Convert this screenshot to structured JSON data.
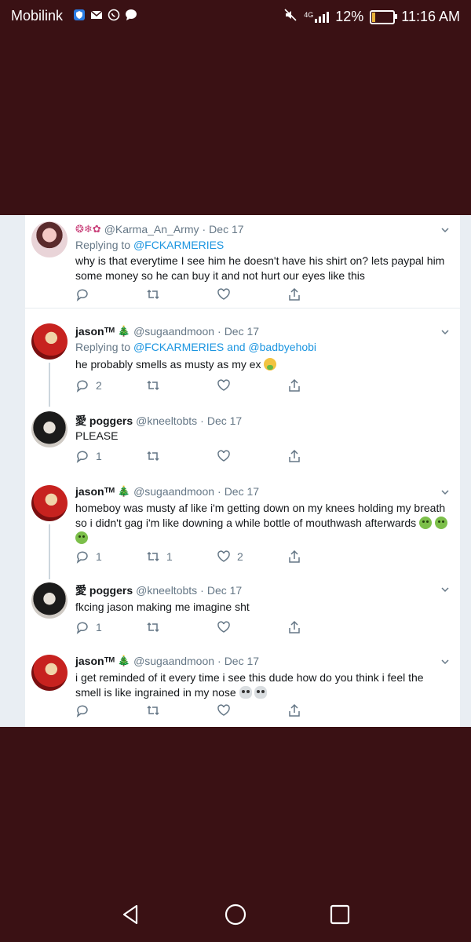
{
  "status_bar": {
    "carrier": "Mobilink",
    "network": "4G",
    "battery": "12%",
    "battery_level": 0.12,
    "time": "11:16 AM"
  },
  "tweets": [
    {
      "prefix": "❂❄✿",
      "name": "",
      "handle": "@Karma_An_Army",
      "date": "Dec 17",
      "replying_label": "Replying to",
      "replying_to": [
        "@FCKARMERIES"
      ],
      "text": "why is that everytime I see him he doesn't have his shirt on? lets paypal him some money so he can buy it and not hurt our eyes like this",
      "replies": "",
      "retweets": "",
      "likes": ""
    },
    {
      "name": "jasonᵀᴹ",
      "handle": "@sugaandmoon",
      "date": "Dec 17",
      "replying_label": "Replying to",
      "replying_to": [
        "@FCKARMERIES",
        "and",
        "@badbyehobi"
      ],
      "text": "he probably smells as musty as my ex",
      "replies": "2",
      "retweets": "",
      "likes": ""
    },
    {
      "name": "愛 poggers",
      "handle": "@kneeltobts",
      "date": "Dec 17",
      "text": "PLEASE",
      "replies": "1",
      "retweets": "",
      "likes": ""
    },
    {
      "name": "jasonᵀᴹ",
      "handle": "@sugaandmoon",
      "date": "Dec 17",
      "text": "homeboy was musty af like i'm getting down on my knees holding my breath so i didn't gag i'm like downing a while bottle of mouthwash afterwards",
      "replies": "1",
      "retweets": "1",
      "likes": "2"
    },
    {
      "name": "愛 poggers",
      "handle": "@kneeltobts",
      "date": "Dec 17",
      "text": "fkcing jason making me imagine sht",
      "replies": "1",
      "retweets": "",
      "likes": ""
    },
    {
      "name": "jasonᵀᴹ",
      "handle": "@sugaandmoon",
      "date": "Dec 17",
      "text": "i get reminded of it every time i see this dude how do you think i feel the smell is like ingrained in my nose",
      "replies": "",
      "retweets": "",
      "likes": ""
    }
  ],
  "icons": {
    "reply": "comment-icon",
    "retweet": "retweet-icon",
    "like": "heart-icon",
    "share": "share-icon"
  },
  "colors": {
    "background": "#3a1114",
    "link": "#1b95e0",
    "muted": "#657786"
  }
}
